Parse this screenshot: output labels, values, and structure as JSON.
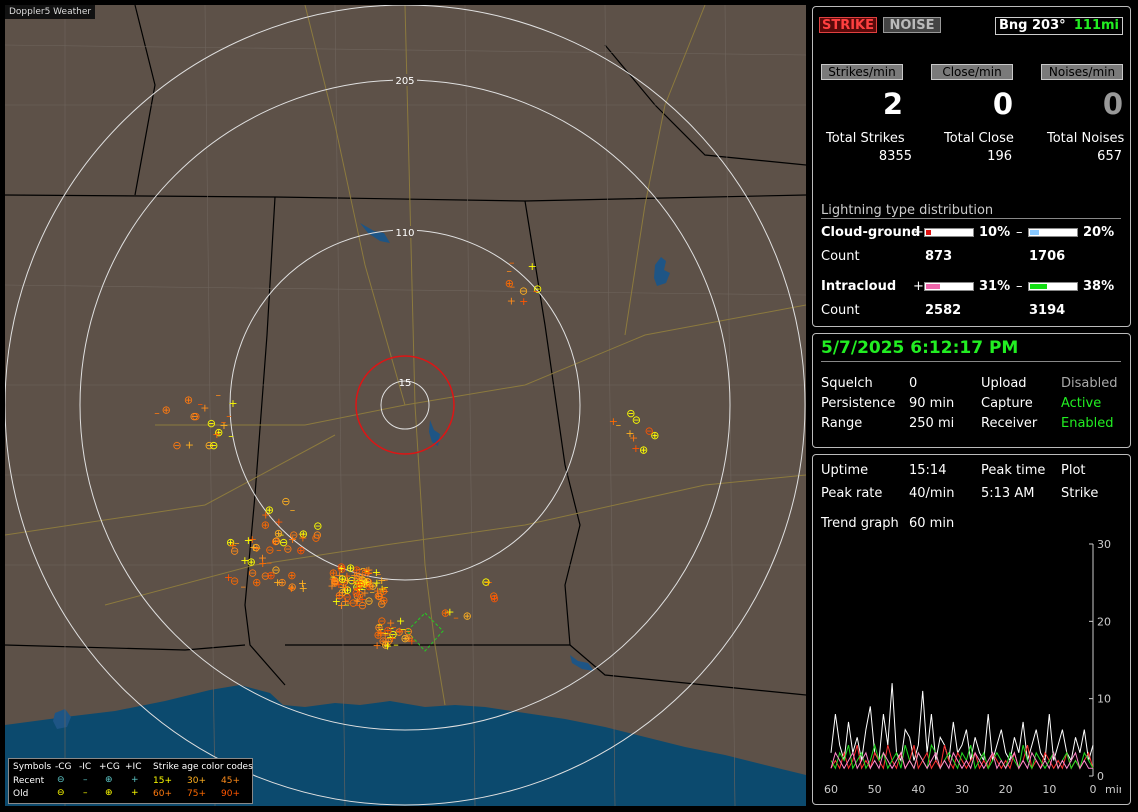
{
  "app": {
    "title": "Doppler5 Weather"
  },
  "map": {
    "range_ring_labels": [
      "205",
      "110",
      "15"
    ],
    "legend": {
      "symbols_label": "Symbols",
      "col_neg_cg": "-CG",
      "col_neg_ic": "-IC",
      "col_pos_cg": "+CG",
      "col_pos_ic": "+IC",
      "age_title": "Strike age color codes",
      "recent_label": "Recent",
      "old_label": "Old",
      "ages_recent": [
        "15+",
        "30+",
        "45+"
      ],
      "ages_old": [
        "60+",
        "75+",
        "90+"
      ],
      "age_colors": [
        "#ffff00",
        "#ffb020",
        "#ff8c1a",
        "#ff7a10",
        "#ff6a00",
        "#ff5500"
      ]
    }
  },
  "status": {
    "strike_tab": "STRIKE",
    "noise_tab": "NOISE",
    "bearing": "Bng 203°",
    "distance": "111mi",
    "rate_buttons": [
      "Strikes/min",
      "Close/min",
      "Noises/min"
    ],
    "rate_values": [
      "2",
      "0",
      "0"
    ],
    "totals_labels": [
      "Total Strikes",
      "Total Close",
      "Total Noises"
    ],
    "totals_values": [
      "8355",
      "196",
      "657"
    ],
    "distribution_title": "Lightning type distribution",
    "cg_label": "Cloud-ground",
    "ic_label": "Intracloud",
    "count_label": "Count",
    "plus": "+",
    "minus": "–",
    "cg_pos_pct": "10%",
    "cg_neg_pct": "20%",
    "cg_pos_count": "873",
    "cg_neg_count": "1706",
    "ic_pos_pct": "31%",
    "ic_neg_pct": "38%",
    "ic_pos_count": "2582",
    "ic_neg_count": "3194",
    "bar_fractions": {
      "cg_pos": 0.1,
      "cg_neg": 0.2,
      "ic_pos": 0.31,
      "ic_neg": 0.38
    },
    "colors": {
      "cg_pos": "#dd1111",
      "cg_neg": "#88c8ff",
      "ic_pos": "#ee66aa",
      "ic_neg": "#11dd11",
      "green": "#22ee22"
    }
  },
  "settings": {
    "datetime": "5/7/2025 6:12:17 PM",
    "squelch_label": "Squelch",
    "squelch_value": "0",
    "persistence_label": "Persistence",
    "persistence_value": "90 min",
    "range_label": "Range",
    "range_value": "250 mi",
    "upload_label": "Upload",
    "upload_value": "Disabled",
    "capture_label": "Capture",
    "capture_value": "Active",
    "receiver_label": "Receiver",
    "receiver_value": "Enabled"
  },
  "stats": {
    "uptime_label": "Uptime",
    "uptime_value": "15:14",
    "peak_time_label": "Peak time",
    "peak_time_value": "5:13 AM",
    "plot_label": "Plot",
    "plot_value": "Strike",
    "peak_rate_label": "Peak rate",
    "peak_rate_value": "40/min",
    "trend_label": "Trend graph",
    "trend_value": "60 min"
  },
  "chart_data": {
    "type": "line",
    "xlabel": "min",
    "x_ticks": [
      "60",
      "50",
      "40",
      "30",
      "20",
      "10",
      "0"
    ],
    "y_ticks": [
      "30",
      "20",
      "10",
      "0"
    ],
    "ylim": [
      0,
      30
    ],
    "xlim": [
      60,
      0
    ],
    "x": [
      60,
      59,
      58,
      57,
      56,
      55,
      54,
      53,
      52,
      51,
      50,
      49,
      48,
      47,
      46,
      45,
      44,
      43,
      42,
      41,
      40,
      39,
      38,
      37,
      36,
      35,
      34,
      33,
      32,
      31,
      30,
      29,
      28,
      27,
      26,
      25,
      24,
      23,
      22,
      21,
      20,
      19,
      18,
      17,
      16,
      15,
      14,
      13,
      12,
      11,
      10,
      9,
      8,
      7,
      6,
      5,
      4,
      3,
      2,
      1,
      0
    ],
    "series": [
      {
        "color": "#ffffff",
        "values": [
          3,
          8,
          4,
          2,
          7,
          3,
          5,
          2,
          6,
          9,
          3,
          2,
          8,
          4,
          12,
          3,
          2,
          6,
          5,
          2,
          4,
          11,
          3,
          8,
          2,
          5,
          4,
          2,
          7,
          3,
          4,
          6,
          2,
          5,
          3,
          2,
          8,
          2,
          4,
          6,
          3,
          2,
          5,
          3,
          7,
          2,
          4,
          6,
          3,
          2,
          8,
          2,
          4,
          6,
          3,
          2,
          5,
          3,
          6,
          2,
          4
        ]
      },
      {
        "color": "#ff3333",
        "values": [
          1,
          2,
          1,
          3,
          1,
          2,
          4,
          1,
          2,
          1,
          3,
          2,
          1,
          4,
          2,
          1,
          3,
          1,
          2,
          4,
          1,
          2,
          3,
          1,
          2,
          1,
          4,
          2,
          1,
          3,
          2,
          1,
          2,
          3,
          1,
          2,
          1,
          3,
          2,
          1,
          2,
          1,
          3,
          1,
          2,
          4,
          1,
          2,
          1,
          3,
          2,
          1,
          2,
          1,
          3,
          1,
          2,
          1,
          2,
          3,
          1
        ]
      },
      {
        "color": "#22dd22",
        "values": [
          2,
          1,
          3,
          2,
          4,
          1,
          2,
          3,
          1,
          2,
          4,
          2,
          3,
          1,
          2,
          3,
          1,
          4,
          2,
          1,
          3,
          2,
          1,
          4,
          3,
          1,
          2,
          3,
          2,
          1,
          3,
          2,
          4,
          1,
          2,
          3,
          1,
          2,
          3,
          2,
          1,
          3,
          2,
          1,
          4,
          2,
          1,
          3,
          2,
          1,
          2,
          3,
          1,
          2,
          3,
          1,
          2,
          1,
          3,
          2,
          1
        ]
      },
      {
        "color": "#ff88cc",
        "values": [
          1,
          3,
          2,
          1,
          2,
          3,
          1,
          2,
          3,
          1,
          2,
          1,
          3,
          2,
          1,
          2,
          3,
          1,
          2,
          1,
          3,
          2,
          1,
          2,
          3,
          1,
          2,
          1,
          3,
          2,
          1,
          2,
          1,
          3,
          2,
          1,
          2,
          3,
          1,
          2,
          1,
          2,
          3,
          1,
          2,
          1,
          3,
          2,
          1,
          2,
          1,
          3,
          1,
          2,
          1,
          2,
          3,
          1,
          2,
          1,
          1
        ]
      }
    ]
  }
}
